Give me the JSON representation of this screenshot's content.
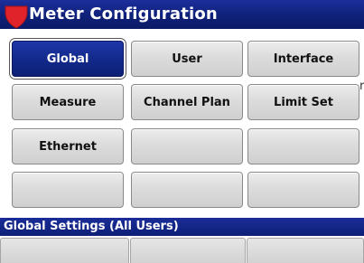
{
  "window": {
    "title": "Meter Configuration",
    "icon": "shield-icon",
    "accent_color": "#0f2078",
    "icon_color": "#e0222a"
  },
  "grid": {
    "buttons": [
      {
        "label": "Global",
        "selected": true
      },
      {
        "label": "User",
        "selected": false
      },
      {
        "label": "Interface",
        "selected": false
      },
      {
        "label": "Measure",
        "selected": false
      },
      {
        "label": "Channel Plan",
        "selected": false
      },
      {
        "label": "Limit Set",
        "selected": false
      },
      {
        "label": "Ethernet",
        "selected": false
      },
      {
        "label": "",
        "selected": false
      },
      {
        "label": "",
        "selected": false
      },
      {
        "label": "",
        "selected": false
      },
      {
        "label": "",
        "selected": false
      },
      {
        "label": "",
        "selected": false
      }
    ]
  },
  "edge_text": "r",
  "status": {
    "text": "Global Settings (All Users)"
  },
  "softkeys": [
    "",
    "",
    ""
  ]
}
